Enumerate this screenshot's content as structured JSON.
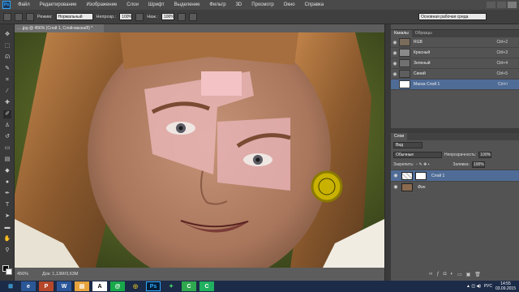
{
  "menu": {
    "items": [
      "Файл",
      "Редактирование",
      "Изображение",
      "Слои",
      "Шрифт",
      "Выделение",
      "Фильтр",
      "3D",
      "Просмотр",
      "Окно",
      "Справка"
    ]
  },
  "options": {
    "mode_label": "Режим:",
    "mode_value": "Нормальный",
    "opacity_label": "Непрозр.:",
    "opacity_value": "100%",
    "pressure_label": "Наж.:",
    "pressure_value": "100%",
    "workspace": "Основная рабочая среда"
  },
  "document": {
    "tab_title": "... .jpg @ 456% (Слой 1, Слой-маска/8) *",
    "zoom": "456%",
    "doc_info": "Док: 1,13М/3,63М"
  },
  "channels_panel": {
    "tabs": [
      "Каналы",
      "Образцы"
    ],
    "rows": [
      {
        "name": "RGB",
        "shortcut": "Ctrl+2"
      },
      {
        "name": "Красный",
        "shortcut": "Ctrl+3"
      },
      {
        "name": "Зеленый",
        "shortcut": "Ctrl+4"
      },
      {
        "name": "Синий",
        "shortcut": "Ctrl+5"
      },
      {
        "name": "Маска Слой 1",
        "shortcut": "Ctrl+\\"
      }
    ]
  },
  "layers_panel": {
    "tab": "Слои",
    "kind": "Вид",
    "blend_mode": "Обычные",
    "opacity_label": "Непрозрачность:",
    "opacity_value": "100%",
    "lock_label": "Закрепить:",
    "fill_label": "Заливка:",
    "fill_value": "100%",
    "layers": [
      {
        "name": "Слой 1",
        "selected": true
      },
      {
        "name": "Фон",
        "selected": false
      }
    ]
  },
  "taskbar": {
    "language": "РУС",
    "time": "14:55",
    "date": "03.09.2015"
  },
  "icons": {
    "eye": "eye-icon",
    "brush": "brush-icon",
    "move": "move-icon",
    "lasso": "lasso-icon",
    "windows": "windows-start-icon"
  },
  "colors": {
    "panel_bg": "#535353",
    "selection_blue": "#4f6c97",
    "taskbar": "#1c2b47"
  }
}
